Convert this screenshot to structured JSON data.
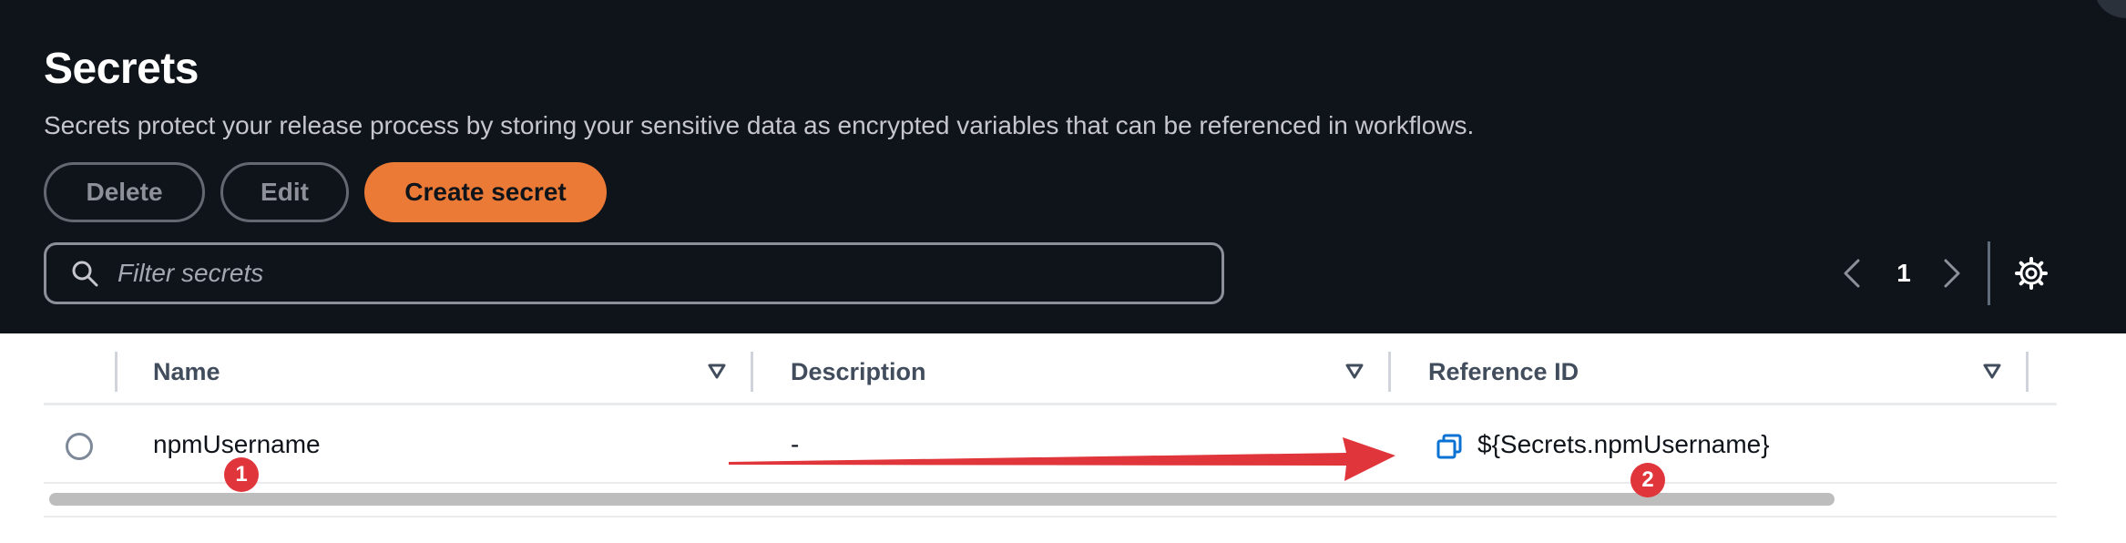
{
  "header": {
    "title": "Secrets",
    "description": "Secrets protect your release process by storing your sensitive data as encrypted variables that can be referenced in workflows."
  },
  "actions": {
    "delete_label": "Delete",
    "edit_label": "Edit",
    "create_label": "Create secret"
  },
  "filter": {
    "placeholder": "Filter secrets",
    "icon": "search-icon"
  },
  "pagination": {
    "current_page": "1",
    "prev_icon": "chevron-left-icon",
    "next_icon": "chevron-right-icon",
    "settings_icon": "gear-icon"
  },
  "table": {
    "columns": [
      {
        "label": "Name"
      },
      {
        "label": "Description"
      },
      {
        "label": "Reference ID"
      }
    ],
    "rows": [
      {
        "name": "npmUsername",
        "description": "-",
        "reference_id": "${Secrets.npmUsername}"
      }
    ]
  },
  "annotations": {
    "badge_1": "1",
    "badge_2": "2",
    "arrow_color": "#e0353a"
  },
  "colors": {
    "header_bg": "#0f141a",
    "primary": "#eb7a36",
    "link_blue": "#0972d3"
  }
}
